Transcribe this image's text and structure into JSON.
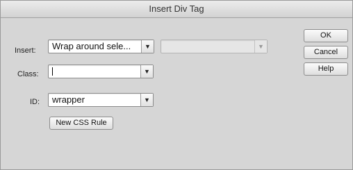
{
  "dialog": {
    "title": "Insert Div Tag"
  },
  "form": {
    "insert_label": "Insert:",
    "insert_value": "Wrap around sele...",
    "insert_secondary_value": "",
    "class_label": "Class:",
    "class_value": "",
    "id_label": "ID:",
    "id_value": "wrapper",
    "new_css_rule_label": "New CSS Rule"
  },
  "buttons": {
    "ok": "OK",
    "cancel": "Cancel",
    "help": "Help"
  },
  "icons": {
    "dropdown": "chevron-down-icon"
  }
}
